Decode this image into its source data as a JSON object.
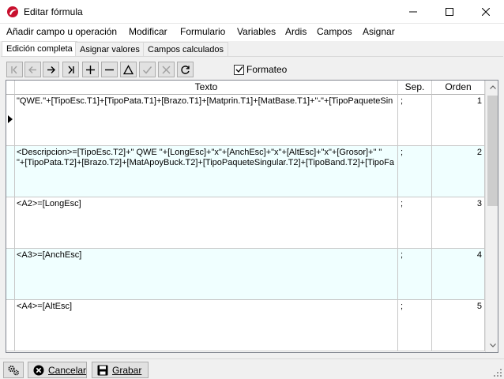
{
  "window": {
    "title": "Editar fórmula"
  },
  "menu": [
    "Añadir campo u operación",
    "Modificar",
    "Formulario",
    "Variables",
    "Ardis",
    "Campos",
    "Asignar"
  ],
  "tabs": [
    "Edición completa",
    "Asignar valores",
    "Campos calculados"
  ],
  "toolbar": {
    "format_label": "Formateo",
    "format_checked": true
  },
  "grid": {
    "headers": {
      "text": "Texto",
      "sep": "Sep.",
      "order": "Orden"
    },
    "rows": [
      {
        "lines": [
          "\"QWE.\"+[TipoEsc.T1]+[TipoPata.T1]+[Brazo.T1]+[Matprin.T1]+[MatBase.T1]+\"-\"+[TipoPaqueteSin"
        ],
        "sep": ";",
        "order": "1"
      },
      {
        "lines": [
          "<Descripcion>=[TipoEsc.T2]+\" QWE \"+[LongEsc]+\"x\"+[AnchEsc]+\"x\"+[AltEsc]+\"x\"+[Grosor]+\" \"",
          "\"+[TipoPata.T2]+[Brazo.T2]+[MatApoyBuck.T2]+[TipoPaqueteSingular.T2]+[TipoBand.T2]+[TipoFa"
        ],
        "sep": ";",
        "order": "2"
      },
      {
        "lines": [
          "<A2>=[LongEsc]"
        ],
        "sep": ";",
        "order": "3"
      },
      {
        "lines": [
          "<A3>=[AnchEsc]"
        ],
        "sep": ";",
        "order": "4"
      },
      {
        "lines": [
          "<A4>=[AltEsc]"
        ],
        "sep": ";",
        "order": "5"
      }
    ]
  },
  "footer": {
    "cancel_label": "Cancelar",
    "save_label": "Grabar"
  }
}
